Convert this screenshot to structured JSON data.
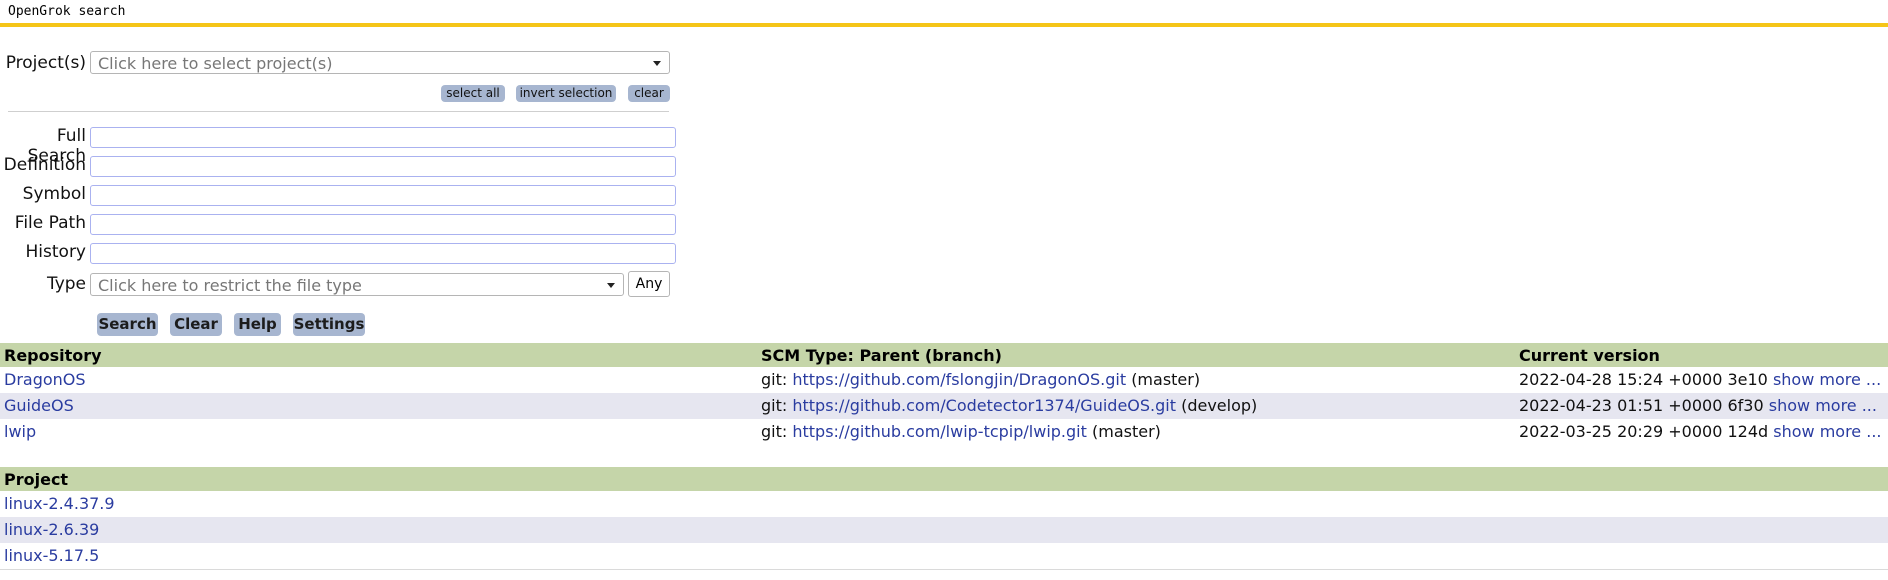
{
  "header": {
    "title": "OpenGrok search"
  },
  "form": {
    "projects_label": "Project(s)",
    "projects_placeholder": "Click here to select project(s)",
    "select_all": "select all",
    "invert_selection": "invert selection",
    "clear_small": "clear",
    "fields": [
      {
        "label": "Full Search",
        "value": ""
      },
      {
        "label": "Definition",
        "value": ""
      },
      {
        "label": "Symbol",
        "value": ""
      },
      {
        "label": "File Path",
        "value": ""
      },
      {
        "label": "History",
        "value": ""
      }
    ],
    "type_label": "Type",
    "type_placeholder": "Click here to restrict the file type",
    "any": "Any",
    "buttons": {
      "search": "Search",
      "clear": "Clear",
      "help": "Help",
      "settings": "Settings"
    }
  },
  "repos": {
    "headers": {
      "repository": "Repository",
      "scm": "SCM Type: Parent (branch)",
      "version": "Current version"
    },
    "rows": [
      {
        "name": "DragonOS",
        "scm_prefix": "git:",
        "url": "https://github.com/fslongjin/DragonOS.git",
        "branch": "(master)",
        "version": "2022-04-28 15:24 +0000 3e10",
        "more": "show more ..."
      },
      {
        "name": "GuideOS",
        "scm_prefix": "git:",
        "url": "https://github.com/Codetector1374/GuideOS.git",
        "branch": "(develop)",
        "version": "2022-04-23 01:51 +0000 6f30",
        "more": "show more ..."
      },
      {
        "name": "lwip",
        "scm_prefix": "git:",
        "url": "https://github.com/lwip-tcpip/lwip.git",
        "branch": "(master)",
        "version": "2022-03-25 20:29 +0000 124d",
        "more": "show more ..."
      }
    ]
  },
  "projects": {
    "header": "Project",
    "items": [
      "linux-2.4.37.9",
      "linux-2.6.39",
      "linux-5.17.5"
    ]
  },
  "colors": {
    "accent_bar": "#f5c518",
    "button_bg": "#a7b6d0",
    "table_header_bg": "#c5d5a9",
    "alt_row_bg": "#e6e6f0",
    "link": "#2a3ca0"
  }
}
